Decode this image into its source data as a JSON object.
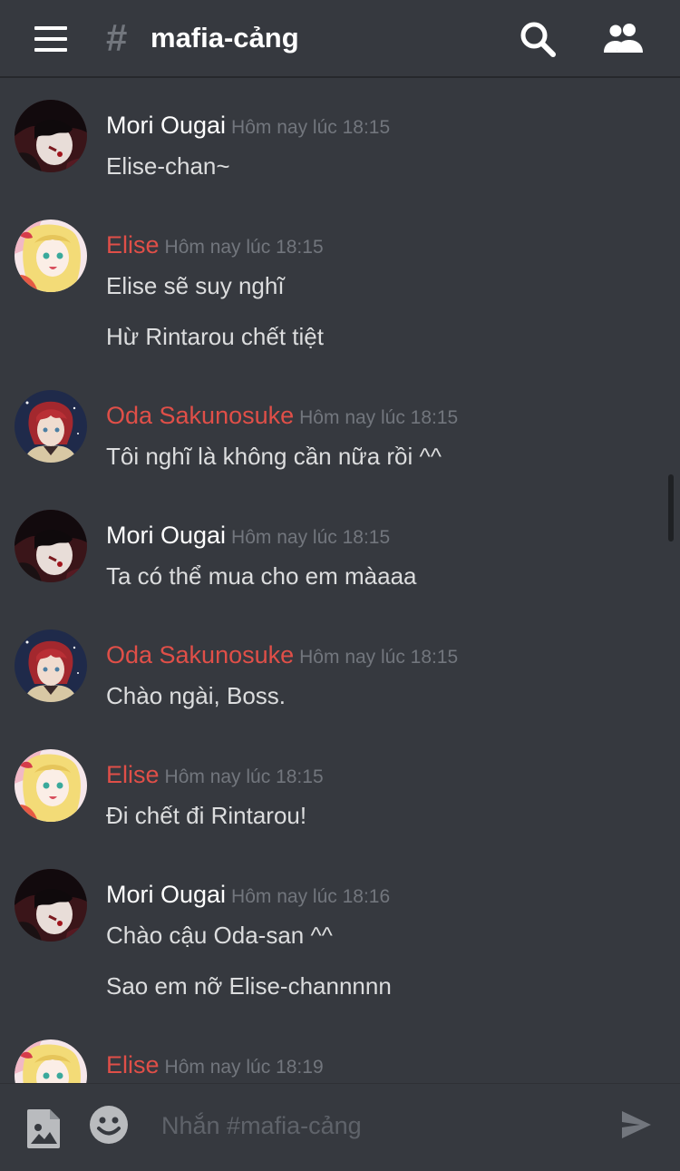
{
  "header": {
    "hash": "#",
    "channel": "mafia-cảng"
  },
  "messages": [
    {
      "author": "Mori Ougai",
      "author_color": "#ffffff",
      "avatar": "mori",
      "timestamp": "Hôm nay lúc 18:15",
      "lines": [
        "Elise-chan~"
      ]
    },
    {
      "author": "Elise",
      "author_color": "#e04f48",
      "avatar": "elise",
      "timestamp": "Hôm nay lúc 18:15",
      "lines": [
        "Elise sẽ suy nghĩ",
        "Hừ Rintarou chết tiệt"
      ]
    },
    {
      "author": "Oda Sakunosuke",
      "author_color": "#e04f48",
      "avatar": "oda",
      "timestamp": "Hôm nay lúc 18:15",
      "lines": [
        "Tôi nghĩ là không cần nữa rồi ^^"
      ]
    },
    {
      "author": "Mori Ougai",
      "author_color": "#ffffff",
      "avatar": "mori",
      "timestamp": "Hôm nay lúc 18:15",
      "lines": [
        "Ta có thể mua cho em màaaa"
      ]
    },
    {
      "author": "Oda Sakunosuke",
      "author_color": "#e04f48",
      "avatar": "oda",
      "timestamp": "Hôm nay lúc 18:15",
      "lines": [
        "Chào ngài, Boss."
      ]
    },
    {
      "author": "Elise",
      "author_color": "#e04f48",
      "avatar": "elise",
      "timestamp": "Hôm nay lúc 18:15",
      "lines": [
        "Đi chết đi Rintarou!"
      ]
    },
    {
      "author": "Mori Ougai",
      "author_color": "#ffffff",
      "avatar": "mori",
      "timestamp": "Hôm nay lúc 18:16",
      "lines": [
        "Chào cậu Oda-san ^^",
        "Sao em nỡ Elise-channnnn"
      ]
    },
    {
      "author": "Elise",
      "author_color": "#e04f48",
      "avatar": "elise",
      "timestamp": "Hôm nay lúc 18:19",
      "lines": []
    }
  ],
  "composer": {
    "placeholder": "Nhắn #mafia-cảng"
  },
  "icons": {
    "menu": "hamburger-menu-icon",
    "search": "search-icon",
    "members": "members-icon",
    "attach": "image-icon",
    "emoji": "emoji-icon",
    "send": "send-icon"
  },
  "colors": {
    "background": "#36393f",
    "author_white": "#ffffff",
    "author_red": "#e04f48",
    "timestamp": "#72767d"
  }
}
